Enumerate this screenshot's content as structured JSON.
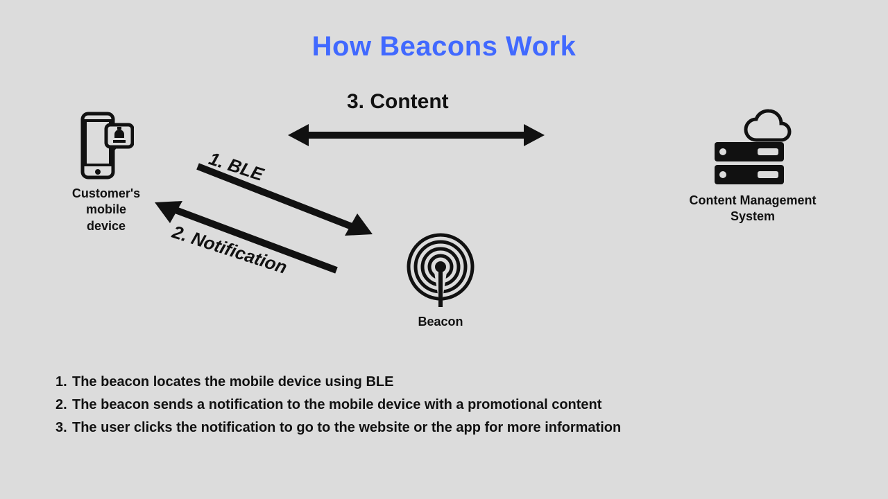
{
  "title": "How Beacons Work",
  "nodes": {
    "mobile": {
      "label_l1": "Customer's mobile",
      "label_l2": "device"
    },
    "beacon": {
      "label": "Beacon"
    },
    "cms": {
      "label_l1": "Content Management",
      "label_l2": "System"
    }
  },
  "arrows": {
    "content": "3. Content",
    "ble": "1. BLE",
    "notification": "2. Notification"
  },
  "explanation": [
    {
      "num": "1.",
      "text": "The beacon locates the mobile device using BLE"
    },
    {
      "num": "2.",
      "text": "The beacon sends a notification to the mobile device with a promotional content"
    },
    {
      "num": "3.",
      "text": "The user clicks the notification to go to the website or the app for more information"
    }
  ]
}
